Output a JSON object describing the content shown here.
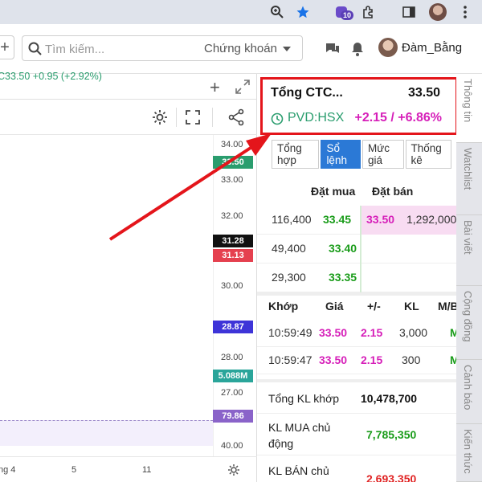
{
  "browser": {
    "icons": [
      "zoom-icon",
      "star-icon",
      "extension-icon",
      "puzzle-icon",
      "sidebar-icon",
      "profile-avatar",
      "kebab-menu-icon"
    ],
    "extension_badge": "10"
  },
  "header": {
    "search_placeholder": "Tìm kiếm...",
    "search_scope": "Chứng khoán",
    "username": "Đàm_Bằng"
  },
  "chart": {
    "legend": "C33.50 +0.95 (+2.92%)",
    "price_ticks": [
      "34.00",
      "33.00",
      "32.00",
      "30.00",
      "28.00",
      "27.00",
      "40.00"
    ],
    "price_labels": [
      {
        "text": "33.50",
        "color": "#2a9d6e"
      },
      {
        "text": "31.28",
        "color": "#111111"
      },
      {
        "text": "31.13",
        "color": "#e5404f"
      },
      {
        "text": "28.87",
        "color": "#3e34d8"
      },
      {
        "text": "5.088M",
        "color": "#2aa59a"
      },
      {
        "text": "79.86",
        "color": "#8a63c9"
      }
    ],
    "time_labels": [
      "ng 4",
      "5",
      "11"
    ]
  },
  "info": {
    "name": "Tổng CTC...",
    "price": "33.50",
    "exchange": "PVD:HSX",
    "change": "+2.15 / +6.86%",
    "subtabs": [
      {
        "label": "Tổng hợp"
      },
      {
        "label": "Sổ lệnh"
      },
      {
        "label": "Mức giá"
      },
      {
        "label": "Thống kê"
      }
    ],
    "book_headers": {
      "buy": "Đặt mua",
      "sell": "Đặt bán"
    },
    "book_rows": [
      {
        "buy_vol": "116,400",
        "buy_price": "33.45",
        "sell_price": "33.50",
        "sell_vol": "1,292,000"
      },
      {
        "buy_vol": "49,400",
        "buy_price": "33.40",
        "sell_price": "",
        "sell_vol": ""
      },
      {
        "buy_vol": "29,300",
        "buy_price": "33.35",
        "sell_price": "",
        "sell_vol": ""
      }
    ],
    "trade_headers": {
      "time": "Khớp",
      "price": "Giá",
      "change": "+/-",
      "vol": "KL",
      "side": "M/B"
    },
    "trades": [
      {
        "time": "10:59:49",
        "price": "33.50",
        "change": "2.15",
        "vol": "3,000",
        "side": "M"
      },
      {
        "time": "10:59:47",
        "price": "33.50",
        "change": "2.15",
        "vol": "300",
        "side": "M"
      }
    ],
    "summary": [
      {
        "label": "Tổng KL khớp",
        "value": "10,478,700"
      },
      {
        "label": "KL MUA chủ động",
        "value": "7,785,350"
      },
      {
        "label": "KL BÁN chủ",
        "value": "2,693,350"
      }
    ]
  },
  "side_tabs": [
    "Thông tin",
    "Watchlist",
    "Bài viết",
    "Cộng đồng",
    "Cảnh báo",
    "Kiến thức"
  ],
  "colors": {
    "highlight": "#e4151b",
    "accent": "#2b79d6",
    "up": "#1a9c1a",
    "ceiling": "#d61fb9"
  }
}
